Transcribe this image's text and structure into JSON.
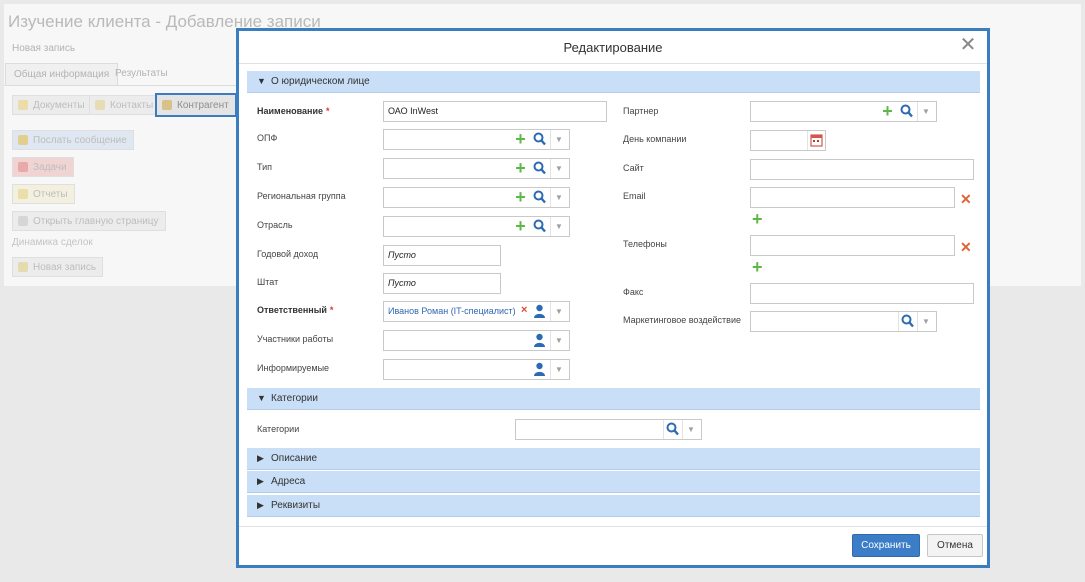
{
  "background": {
    "page_title": "Изучение клиента - Добавление записи",
    "subtitle": "Новая запись",
    "tabs": [
      "Общая информация",
      "Результаты"
    ],
    "toolbar": [
      "Документы",
      "Контакты",
      "Контрагент"
    ],
    "actions": [
      "Послать сообщение",
      "Задачи",
      "Отчеты",
      "Открыть главную страницу"
    ],
    "link": "Динамика сделок",
    "new_record": "Новая запись"
  },
  "modal": {
    "title": "Редактирование",
    "sections": {
      "legal": "О юридическом лице",
      "categories": "Категории",
      "description": "Описание",
      "addresses": "Адреса",
      "requisites": "Реквизиты"
    },
    "left": {
      "name_label": "Наименование",
      "name_value": "ОАО InWest",
      "opf_label": "ОПФ",
      "type_label": "Тип",
      "region_label": "Региональная группа",
      "industry_label": "Отрасль",
      "revenue_label": "Годовой доход",
      "revenue_value": "Пусто",
      "staff_label": "Штат",
      "staff_value": "Пусто",
      "owner_label": "Ответственный",
      "owner_value": "Иванов Роман (IT-специалист)",
      "participants_label": "Участники работы",
      "informed_label": "Информируемые"
    },
    "right": {
      "partner_label": "Партнер",
      "company_day_label": "День компании",
      "site_label": "Сайт",
      "email_label": "Email",
      "phones_label": "Телефоны",
      "fax_label": "Факс",
      "marketing_label": "Маркетинговое воздействие"
    },
    "categories_label": "Категории",
    "required_mark": "*",
    "buttons": {
      "save": "Сохранить",
      "cancel": "Отмена"
    },
    "colors": {
      "accent": "#3b7ec0",
      "section_bg": "#c8dff7",
      "add": "#5db84a",
      "remove": "#e06536"
    }
  }
}
